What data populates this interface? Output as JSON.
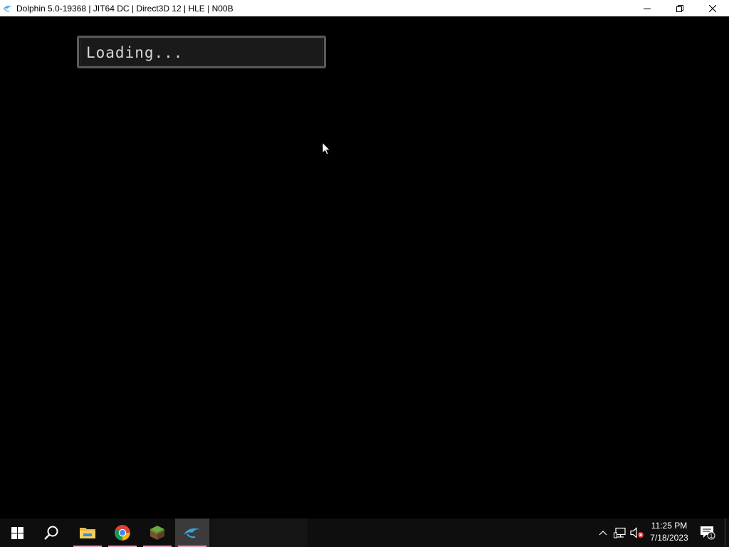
{
  "window": {
    "title": "Dolphin 5.0-19368 | JIT64 DC | Direct3D 12 | HLE | N00B",
    "icon": "dolphin-icon",
    "controls": [
      "minimize-icon",
      "restore-icon",
      "close-icon"
    ]
  },
  "game": {
    "loading_text": "Loading..."
  },
  "taskbar": {
    "items": [
      {
        "name": "start-button",
        "icon": "windows-logo-icon"
      },
      {
        "name": "search-button",
        "icon": "search-icon"
      },
      {
        "name": "file-explorer",
        "icon": "folder-icon"
      },
      {
        "name": "chrome",
        "icon": "chrome-icon"
      },
      {
        "name": "minecraft",
        "icon": "grass-block-icon"
      },
      {
        "name": "dolphin",
        "icon": "dolphin-icon"
      }
    ],
    "tray": {
      "time": "11:25 PM",
      "date": "7/18/2023",
      "notification_count": "1"
    }
  },
  "colors": {
    "titlebar_bg": "#ffffff",
    "game_bg": "#000000",
    "taskbar_bg": "#0e0e0e",
    "running_indicator": "#e8a3b7",
    "dolphin_accent": "#3aa6e0"
  }
}
